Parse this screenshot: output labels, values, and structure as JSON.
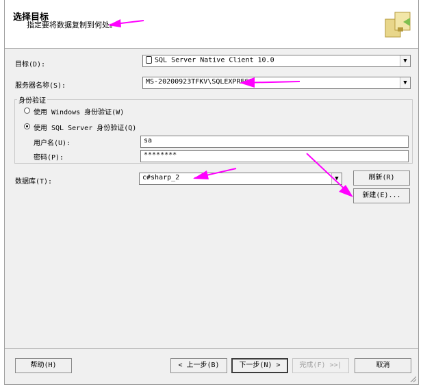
{
  "header": {
    "title": "选择目标",
    "subtitle": "指定要将数据复制到何处。"
  },
  "destination": {
    "label": "目标(D):",
    "value": "SQL Server Native Client 10.0"
  },
  "server": {
    "label": "服务器名称(S):",
    "value": "MS-20200923TFKV\\SQLEXPRESS"
  },
  "auth": {
    "group_title": "身份验证",
    "windows_option": "使用 Windows 身份验证(W)",
    "sql_option": "使用 SQL Server 身份验证(Q)",
    "selected": "sql",
    "username_label": "用户名(U):",
    "username_value": "sa",
    "password_label": "密码(P):",
    "password_value": "********"
  },
  "database": {
    "label": "数据库(T):",
    "value": "c#sharp_2",
    "refresh_button": "刷新(R)",
    "new_button": "新建(E)..."
  },
  "footer": {
    "help_button": "帮助(H)",
    "back_button": "< 上一步(B)",
    "next_button": "下一步(N) >",
    "finish_button": "完成(F) >>|",
    "cancel_button": "取消"
  },
  "colors": {
    "annotation_arrow": "#ff00ff"
  }
}
